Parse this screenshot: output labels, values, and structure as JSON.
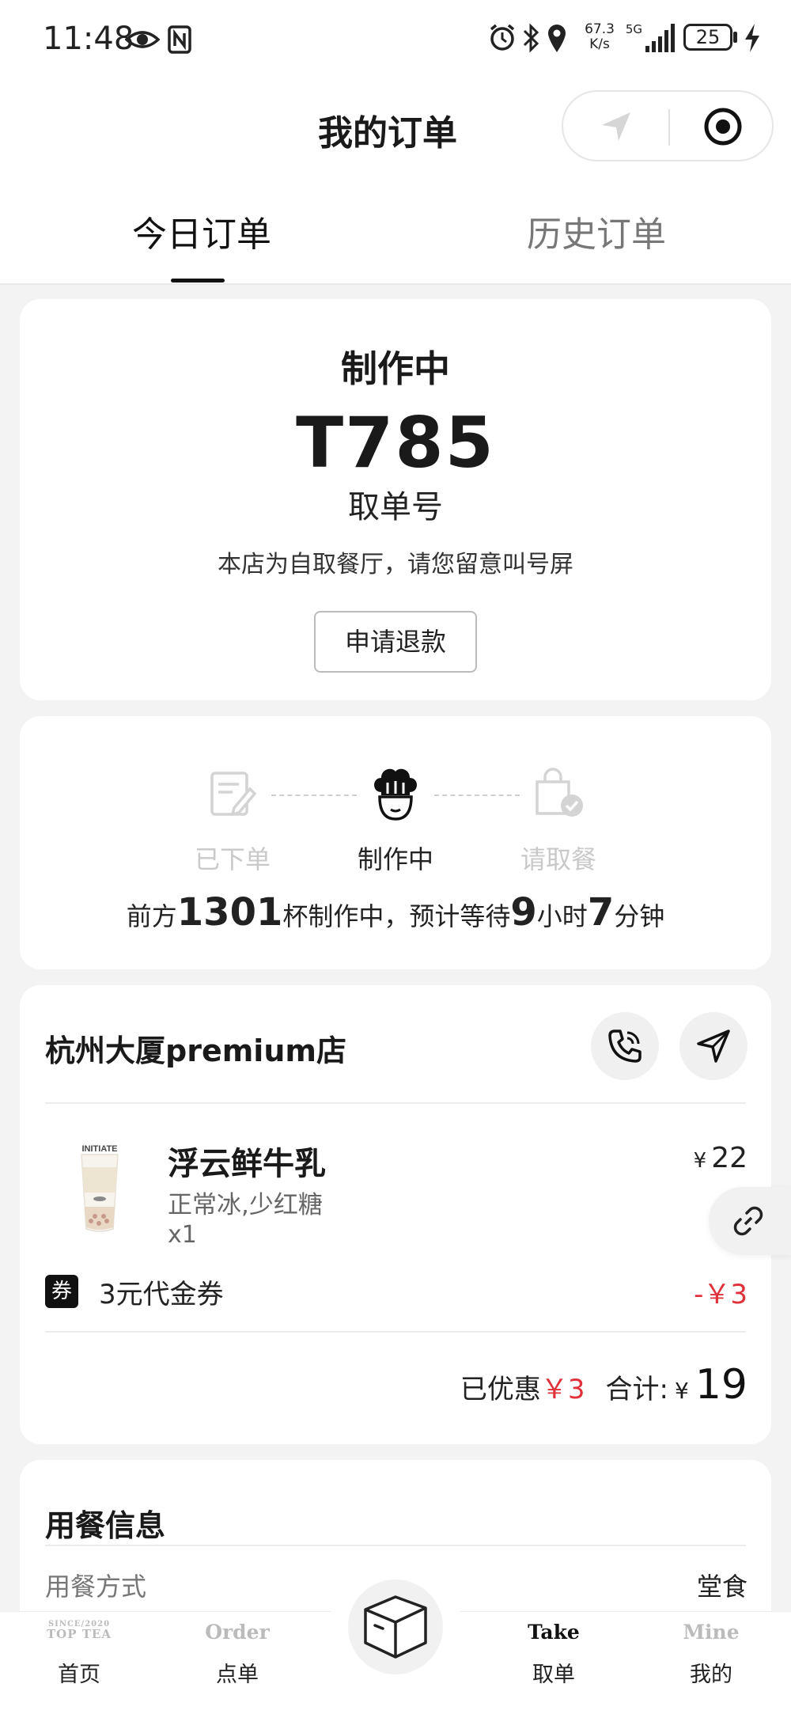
{
  "status_bar": {
    "time": "11:48",
    "network_speed_value": "67.3",
    "network_speed_unit": "K/s",
    "network_type": "5G",
    "battery": "25"
  },
  "header": {
    "title": "我的订单"
  },
  "tabs": {
    "today": "今日订单",
    "history": "历史订单"
  },
  "order": {
    "status": "制作中",
    "pickup_number": "T785",
    "pickup_label": "取单号",
    "notice": "本店为自取餐厅，请您留意叫号屏",
    "refund_button": "申请退款"
  },
  "progress": {
    "steps": [
      "已下单",
      "制作中",
      "请取餐"
    ],
    "current_step": 1,
    "queue_prefix": "前方",
    "queue_cups": "1301",
    "queue_middle": "杯制作中，预计等待",
    "wait_hours": "9",
    "hours_unit": "小时",
    "wait_minutes": "7",
    "minutes_unit": "分钟"
  },
  "store": {
    "name": "杭州大厦premium店",
    "item": {
      "name": "浮云鲜牛乳",
      "options": "正常冰,少红糖",
      "quantity": "x1",
      "currency": "¥",
      "price": "22",
      "thumb_label": "INITIATE"
    },
    "coupon": {
      "badge": "券",
      "name": "3元代金券",
      "amount": "-￥3"
    },
    "totals": {
      "discount_label": "已优惠",
      "discount": "￥3",
      "total_label": "合计:",
      "currency": "¥",
      "total": "19"
    }
  },
  "dining": {
    "title": "用餐信息",
    "method_label": "用餐方式",
    "method_value": "堂食"
  },
  "nav": {
    "home": {
      "logo_line1": "SINCE/2020",
      "logo_line2": "TOP TEA",
      "label": "首页"
    },
    "order": {
      "en": "Order",
      "label": "点单"
    },
    "take": {
      "en": "Take",
      "label": "取单"
    },
    "mine": {
      "en": "Mine",
      "label": "我的"
    },
    "active": "take"
  },
  "colors": {
    "accent_red": "#e0303a",
    "primary": "#111111",
    "background": "#f3f3f3"
  }
}
